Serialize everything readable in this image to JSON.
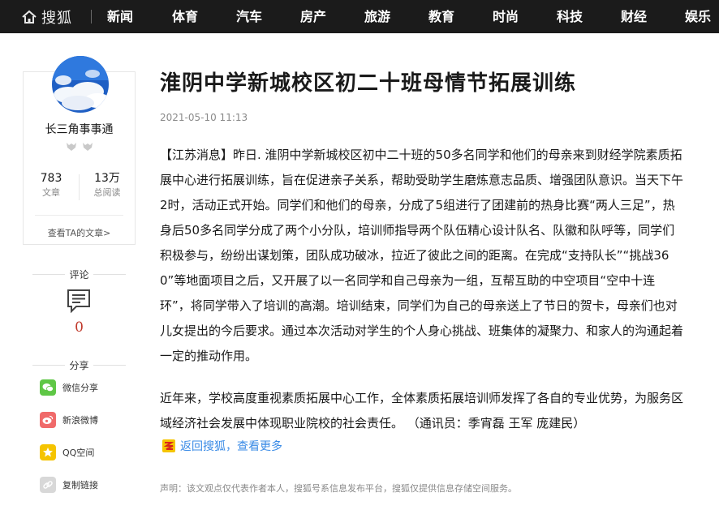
{
  "nav": {
    "brand": "搜狐",
    "items": [
      "新闻",
      "体育",
      "汽车",
      "房产",
      "旅游",
      "教育",
      "时尚",
      "科技",
      "财经",
      "娱乐"
    ]
  },
  "author": {
    "name": "长三角事事通",
    "stats": [
      {
        "value": "783",
        "label": "文章"
      },
      {
        "value": "13万",
        "label": "总阅读"
      }
    ],
    "view_articles": "查看TA的文章>"
  },
  "comments": {
    "label": "评论",
    "count": "0"
  },
  "share": {
    "label": "分享",
    "items": [
      {
        "label": "微信分享",
        "icon": "wechat-icon",
        "color": "#5fc746"
      },
      {
        "label": "新浪微博",
        "icon": "weibo-icon",
        "color": "#f06a6a"
      },
      {
        "label": "QQ空间",
        "icon": "qzone-icon",
        "color": "#f5c400"
      },
      {
        "label": "复制链接",
        "icon": "link-icon",
        "color": "#d8d8d8"
      }
    ]
  },
  "article": {
    "title": "淮阴中学新城校区初二十班母情节拓展训练",
    "time": "2021-05-10 11:13",
    "paragraphs": [
      "【江苏消息】昨日. 淮阴中学新城校区初中二十班的50多名同学和他们的母亲来到财经学院素质拓展中心进行拓展训练，旨在促进亲子关系，帮助受助学生磨炼意志品质、增强团队意识。当天下午2时，活动正式开始。同学们和他们的母亲，分成了5组进行了团建前的热身比赛“两人三足”，热身后50多名同学分成了两个小分队，培训师指导两个队伍精心设计队名、队徽和队呼等，同学们积极参与，纷纷出谋划策，团队成功破冰，拉近了彼此之间的距离。在完成“支持队长”“挑战360”等地面项目之后，又开展了以一名同学和自己母亲为一组，互帮互助的中空项目“空中十连环”，将同学带入了培训的高潮。培训结束，同学们为自己的母亲送上了节日的贺卡，母亲们也对儿女提出的今后要求。通过本次活动对学生的个人身心挑战、班集体的凝聚力、和家人的沟通起着一定的推动作用。",
      "近年来，学校高度重视素质拓展中心工作，全体素质拓展培训师发挥了各自的专业优势，为服务区域经济社会发展中体现职业院校的社会责任。 （通讯员：季宵磊 王军 庞建民）"
    ],
    "back_link": "返回搜狐，查看更多",
    "disclaimer": "声明：该文观点仅代表作者本人，搜狐号系信息发布平台，搜狐仅提供信息存储空间服务。"
  },
  "colors": {
    "nav_bg": "#1b1b1b",
    "link": "#3a8be6",
    "comment_count": "#c0392b"
  }
}
